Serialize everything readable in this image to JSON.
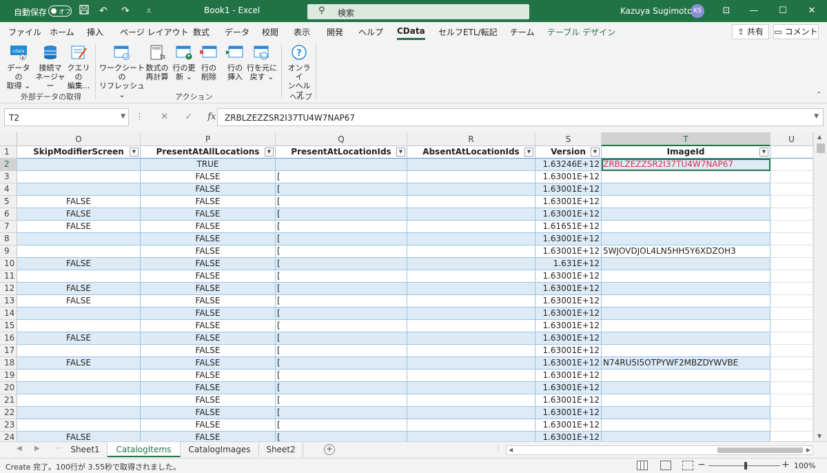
{
  "titlebar": {
    "autosave_label": "自動保存",
    "toggle_label": "オフ",
    "title": "Book1  -  Excel",
    "search_placeholder": "検索",
    "user_name": "Kazuya Sugimoto",
    "user_initials": "KS"
  },
  "ribbon_tabs": [
    "ファイル",
    "ホーム",
    "挿入",
    "ページ レイアウト",
    "数式",
    "データ",
    "校閲",
    "表示",
    "開発",
    "ヘルプ",
    "CData",
    "セルフETL/転記",
    "チーム",
    "テーブル デザイン"
  ],
  "share_label": "共有",
  "comment_label": "コメント",
  "ribbon": {
    "buttons": [
      {
        "l1": "データの",
        "l2": "取得 ⌄"
      },
      {
        "l1": "接続マ",
        "l2": "ネージャー"
      },
      {
        "l1": "クエリの",
        "l2": "編集..."
      },
      {
        "l1": "ワークシートの",
        "l2": "リフレッシュ ⌄"
      },
      {
        "l1": "数式の",
        "l2": "再計算"
      },
      {
        "l1": "行の更",
        "l2": "新 ⌄"
      },
      {
        "l1": "行の",
        "l2": "削除"
      },
      {
        "l1": "行の",
        "l2": "挿入"
      },
      {
        "l1": "行を元に",
        "l2": "戻す ⌄"
      },
      {
        "l1": "オンライ",
        "l2": "ンヘルプ"
      }
    ],
    "groups": [
      "外部データの取得",
      "アクション",
      "ヘルプ"
    ]
  },
  "formula_bar": {
    "name_box": "T2",
    "value": "ZRBLZEZZSR2I37TU4W7NAP67"
  },
  "grid": {
    "columns": [
      "O",
      "P",
      "Q",
      "R",
      "S",
      "T",
      "U"
    ],
    "selected_column": "T",
    "headers": [
      "SkipModifierScreen",
      "PresentAtAllLocations",
      "PresentAtLocationIds",
      "AbsentAtLocationIds",
      "Version",
      "ImageId"
    ],
    "rows": [
      {
        "n": "2",
        "o": "",
        "p": "TRUE",
        "q": "",
        "s": "1.63246E+12",
        "t": "ZRBLZEZZSR2I37TU4W7NAP67"
      },
      {
        "n": "3",
        "o": "",
        "p": "FALSE",
        "q": "[",
        "s": "1.63001E+12",
        "t": ""
      },
      {
        "n": "4",
        "o": "",
        "p": "FALSE",
        "q": "[",
        "s": "1.63001E+12",
        "t": ""
      },
      {
        "n": "5",
        "o": "FALSE",
        "p": "FALSE",
        "q": "[",
        "s": "1.63001E+12",
        "t": ""
      },
      {
        "n": "6",
        "o": "FALSE",
        "p": "FALSE",
        "q": "[",
        "s": "1.63001E+12",
        "t": ""
      },
      {
        "n": "7",
        "o": "FALSE",
        "p": "FALSE",
        "q": "[",
        "s": "1.61651E+12",
        "t": ""
      },
      {
        "n": "8",
        "o": "",
        "p": "FALSE",
        "q": "[",
        "s": "1.63001E+12",
        "t": ""
      },
      {
        "n": "9",
        "o": "",
        "p": "FALSE",
        "q": "[",
        "s": "1.63001E+12",
        "t": "5WJOVDJOL4LN5HH5Y6XDZOH3"
      },
      {
        "n": "10",
        "o": "FALSE",
        "p": "FALSE",
        "q": "[",
        "s": "1.631E+12",
        "t": ""
      },
      {
        "n": "11",
        "o": "",
        "p": "FALSE",
        "q": "[",
        "s": "1.63001E+12",
        "t": ""
      },
      {
        "n": "12",
        "o": "FALSE",
        "p": "FALSE",
        "q": "[",
        "s": "1.63001E+12",
        "t": ""
      },
      {
        "n": "13",
        "o": "FALSE",
        "p": "FALSE",
        "q": "[",
        "s": "1.63001E+12",
        "t": ""
      },
      {
        "n": "14",
        "o": "",
        "p": "FALSE",
        "q": "[",
        "s": "1.63001E+12",
        "t": ""
      },
      {
        "n": "15",
        "o": "",
        "p": "FALSE",
        "q": "[",
        "s": "1.63001E+12",
        "t": ""
      },
      {
        "n": "16",
        "o": "FALSE",
        "p": "FALSE",
        "q": "[",
        "s": "1.63001E+12",
        "t": ""
      },
      {
        "n": "17",
        "o": "",
        "p": "FALSE",
        "q": "[",
        "s": "1.63001E+12",
        "t": ""
      },
      {
        "n": "18",
        "o": "FALSE",
        "p": "FALSE",
        "q": "[",
        "s": "1.63001E+12",
        "t": "N74RU5I5OTPYWF2MBZDYWVBE"
      },
      {
        "n": "19",
        "o": "",
        "p": "FALSE",
        "q": "[",
        "s": "1.63001E+12",
        "t": ""
      },
      {
        "n": "20",
        "o": "",
        "p": "FALSE",
        "q": "[",
        "s": "1.63001E+12",
        "t": ""
      },
      {
        "n": "21",
        "o": "",
        "p": "FALSE",
        "q": "[",
        "s": "1.63001E+12",
        "t": ""
      },
      {
        "n": "22",
        "o": "",
        "p": "FALSE",
        "q": "[",
        "s": "1.63001E+12",
        "t": ""
      },
      {
        "n": "23",
        "o": "",
        "p": "FALSE",
        "q": "[",
        "s": "1.63001E+12",
        "t": ""
      },
      {
        "n": "24",
        "o": "FALSE",
        "p": "FALSE",
        "q": "[",
        "s": "1.63001E+12",
        "t": ""
      }
    ]
  },
  "sheets": [
    "Sheet1",
    "CatalogItems",
    "CatalogImages",
    "Sheet2"
  ],
  "active_sheet": "CatalogItems",
  "status_text": "Create 完了。100行が 3.55秒で取得されました。",
  "zoom_level": "100%",
  "colors": {
    "brand": "#217346",
    "band": "#ddebf7",
    "selected_text": "#e0304a"
  }
}
